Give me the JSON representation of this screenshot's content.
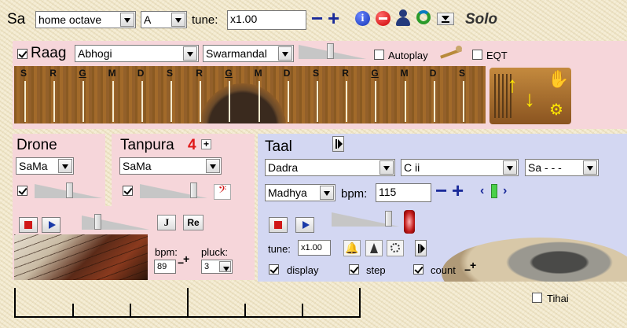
{
  "top": {
    "sa_label": "Sa",
    "octave_value": "home octave",
    "key_value": "A",
    "tune_label": "tune:",
    "tune_value": "x1.00",
    "solo_label": "Solo"
  },
  "raag": {
    "checked": true,
    "label": "Raag",
    "raag_value": "Abhogi",
    "instrument_value": "Swarmandal",
    "autoplay_label": "Autoplay",
    "eqt_label": "EQT",
    "notes": [
      "S",
      "R",
      "G",
      "M",
      "D",
      "S",
      "R",
      "G",
      "M",
      "D",
      "S",
      "R",
      "G",
      "M",
      "D",
      "S"
    ]
  },
  "drone": {
    "title": "Drone",
    "value": "SaMa",
    "j_label": "J",
    "re_label": "Re",
    "bpm_label": "bpm:",
    "bpm_value": "89",
    "pluck_label": "pluck:",
    "pluck_value": "3"
  },
  "tanpura": {
    "title": "Tanpura",
    "count": "4",
    "value": "SaMa"
  },
  "taal": {
    "title": "Taal",
    "taal_value": "Dadra",
    "pitch_value": "C ii",
    "bol_value": "Sa - - -",
    "tempo_value": "Madhya",
    "bpm_label": "bpm:",
    "bpm_value": "115",
    "tune_label": "tune:",
    "tune_value": "x1.00",
    "display_label": "display",
    "step_label": "step",
    "count_label": "count"
  },
  "tihai_label": "Tihai",
  "colors": {
    "pink_panel": "#f6d6da",
    "blue_panel": "#d3d7f2",
    "accent_red": "#e01818",
    "accent_blue": "#1a3aa8"
  }
}
